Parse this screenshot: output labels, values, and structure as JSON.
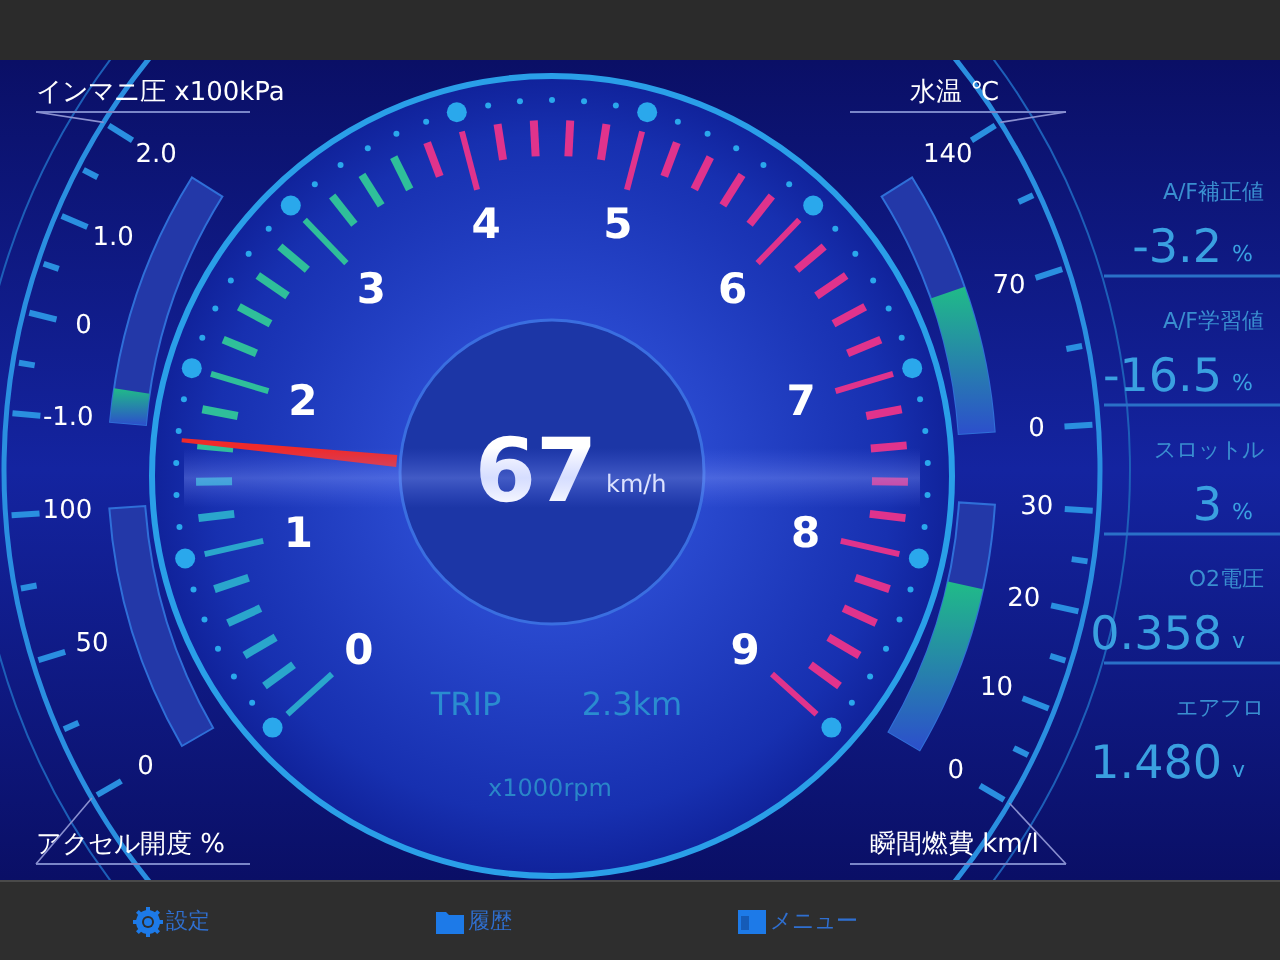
{
  "tachometer": {
    "scale_labels": [
      "0",
      "1",
      "2",
      "3",
      "4",
      "5",
      "6",
      "7",
      "8",
      "9"
    ],
    "unit": "x1000rpm",
    "needle": {
      "level": 0.18
    },
    "speed": {
      "value": "67",
      "unit": "km/h"
    },
    "trip": {
      "label": "TRIP",
      "value": "2.3km"
    }
  },
  "left_gauges": [
    {
      "title": "インマニ圧 x100kPa",
      "scale_labels": [
        "2.0",
        "1.0",
        "0",
        "-1.0"
      ],
      "level": 0.13
    },
    {
      "title": "アクセル開度 %",
      "scale_labels": [
        "100",
        "50",
        "0"
      ],
      "level": 0
    }
  ],
  "right_gauges": [
    {
      "title": "水温 ℃",
      "scale_labels": [
        "140",
        "70",
        "0"
      ],
      "level": 0.55
    },
    {
      "title": "瞬間燃費 km/l",
      "scale_labels": [
        "30",
        "20",
        "10",
        "0"
      ],
      "level": 0.67
    }
  ],
  "readouts": [
    {
      "label": "A/F補正値",
      "value": "-3.2",
      "unit": "%"
    },
    {
      "label": "A/F学習値",
      "value": "-16.5",
      "unit": "%"
    },
    {
      "label": "スロットル",
      "value": "3",
      "unit": "%"
    },
    {
      "label": "O2電圧",
      "value": "0.358",
      "unit": "v"
    },
    {
      "label": "エアフロ",
      "value": "1.480",
      "unit": "v"
    }
  ],
  "bottom_bar": [
    {
      "kind": "gear",
      "label": "設定"
    },
    {
      "kind": "folder",
      "label": "履歴"
    },
    {
      "kind": "window",
      "label": "メニュー"
    }
  ]
}
